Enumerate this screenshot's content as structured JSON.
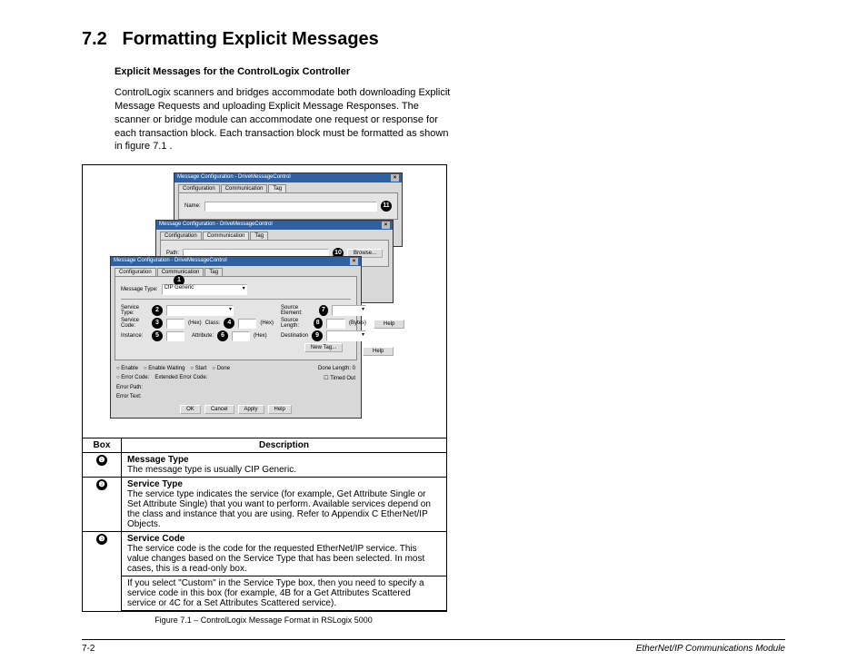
{
  "section": {
    "number": "7.2",
    "title": "Formatting Explicit Messages",
    "subtitle": "Explicit Messages for the ControlLogix Controller",
    "intro": "ControlLogix scanners and bridges accommodate both downloading Explicit Message Requests and uploading Explicit Message Responses. The scanner or bridge module can accommodate one request or response for each transaction block. Each transaction block must be formatted as shown in figure 7.1 ."
  },
  "dialogs": {
    "windowTitle": "Message Configuration - DriveMessageControl",
    "tabs": {
      "config": "Configuration",
      "comm": "Communication",
      "tag": "Tag"
    },
    "fields": {
      "name": "Name:",
      "path": "Path:",
      "messageType": "Message Type:",
      "messageTypeValue": "CIP Generic",
      "serviceType": "Service Type:",
      "serviceCode": "Service Code:",
      "class": "Class:",
      "instance": "Instance:",
      "attribute": "Attribute:",
      "sourceElement": "Source Element:",
      "sourceLength": "Source Length:",
      "destination": "Destination",
      "hex": "(Hex)",
      "bytes": "(Bytes)"
    },
    "buttons": {
      "browse": "Browse...",
      "newTag": "New Tag...",
      "ok": "OK",
      "cancel": "Cancel",
      "apply": "Apply",
      "help": "Help"
    },
    "status": {
      "enable": "Enable",
      "enableWaiting": "Enable Waiting",
      "start": "Start",
      "done": "Done",
      "doneLength": "Done Length: 0",
      "errorCode": "Error Code:",
      "extErrorCode": "Extended Error Code:",
      "timedOut": "Timed Out",
      "errorPath": "Error Path:",
      "errorText": "Error Text:"
    },
    "callouts": {
      "c1": "1",
      "c2": "2",
      "c3": "3",
      "c4": "4",
      "c5": "5",
      "c6": "6",
      "c7": "7",
      "c8": "8",
      "c9": "9",
      "c10": "10",
      "c11": "11"
    }
  },
  "table": {
    "headers": {
      "box": "Box",
      "desc": "Description"
    },
    "rows": [
      {
        "num": "❶",
        "title": "Message Type",
        "body": "The message type is usually CIP Generic."
      },
      {
        "num": "❷",
        "title": "Service Type",
        "body": "The service type indicates the service (for example, Get Attribute Single or Set Attribute Single) that you want to perform. Available services depend on the class and instance that you are using. Refer to Appendix C EtherNet/IP Objects."
      },
      {
        "num": "❸",
        "title": "Service Code",
        "body": "The service code is the code for the requested EtherNet/IP service. This value changes based on the Service Type that has been selected. In most cases, this is a read-only box.",
        "body2": "If you select \"Custom\" in the Service Type box, then you need to specify a service code in this box (for example, 4B for a Get Attributes Scattered service or 4C for a Set Attributes Scattered service)."
      }
    ]
  },
  "caption": "Figure 7.1 – ControlLogix Message Format in RSLogix 5000",
  "footer": {
    "page": "7-2",
    "doc": "EtherNet/IP Communications Module"
  }
}
